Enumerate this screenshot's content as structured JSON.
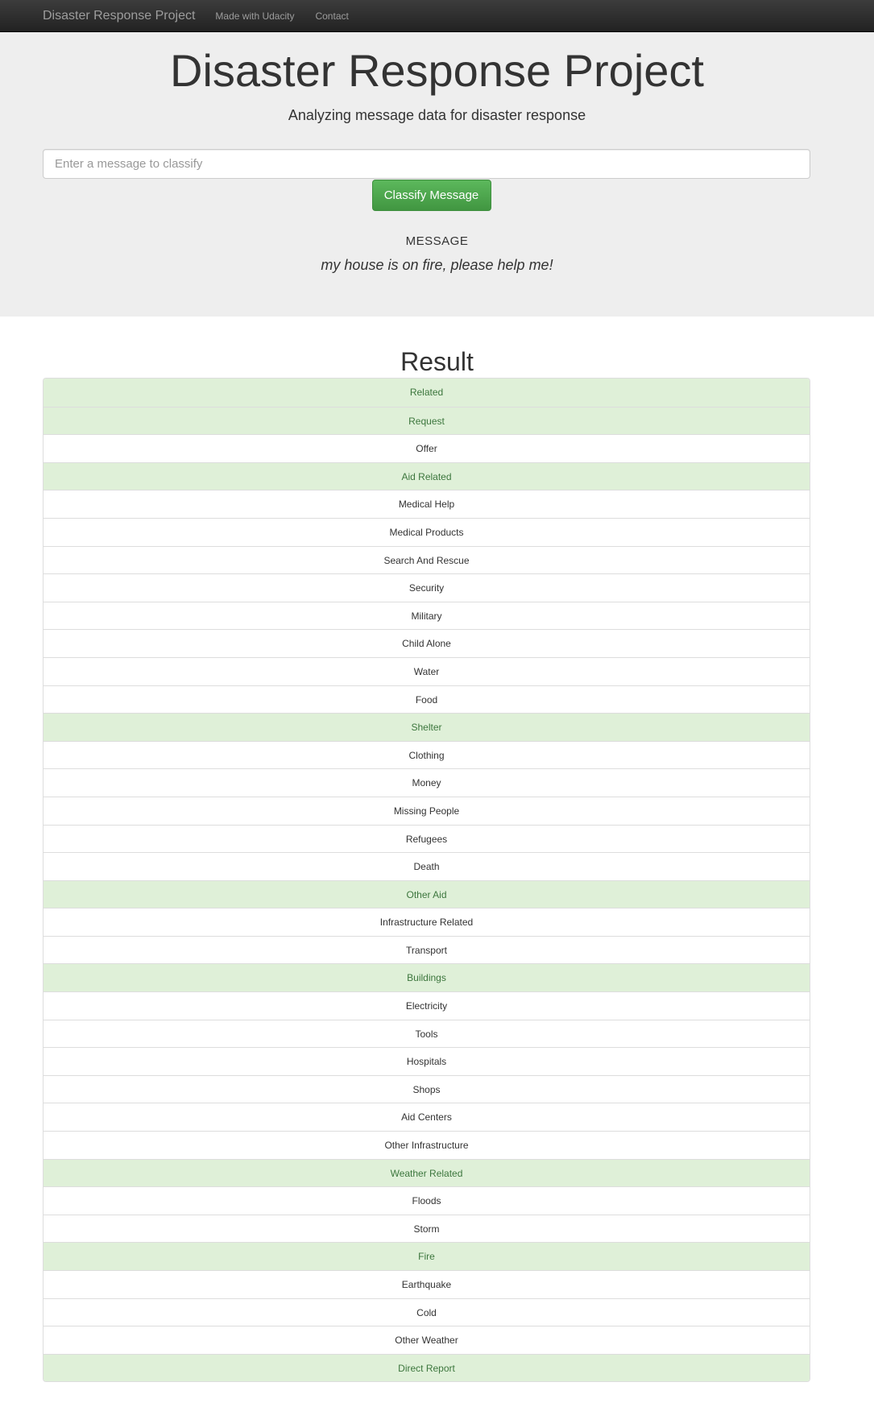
{
  "navbar": {
    "brand": "Disaster Response Project",
    "links": [
      "Made with Udacity",
      "Contact"
    ]
  },
  "header": {
    "title": "Disaster Response Project",
    "subtitle": "Analyzing message data for disaster response"
  },
  "form": {
    "placeholder": "Enter a message to classify",
    "button_label": "Classify Message"
  },
  "message": {
    "heading": "MESSAGE",
    "text": "my house is on fire, please help me!"
  },
  "result": {
    "title": "Result",
    "items": [
      {
        "label": "Related",
        "positive": true
      },
      {
        "label": "Request",
        "positive": true
      },
      {
        "label": "Offer",
        "positive": false
      },
      {
        "label": "Aid Related",
        "positive": true
      },
      {
        "label": "Medical Help",
        "positive": false
      },
      {
        "label": "Medical Products",
        "positive": false
      },
      {
        "label": "Search And Rescue",
        "positive": false
      },
      {
        "label": "Security",
        "positive": false
      },
      {
        "label": "Military",
        "positive": false
      },
      {
        "label": "Child Alone",
        "positive": false
      },
      {
        "label": "Water",
        "positive": false
      },
      {
        "label": "Food",
        "positive": false
      },
      {
        "label": "Shelter",
        "positive": true
      },
      {
        "label": "Clothing",
        "positive": false
      },
      {
        "label": "Money",
        "positive": false
      },
      {
        "label": "Missing People",
        "positive": false
      },
      {
        "label": "Refugees",
        "positive": false
      },
      {
        "label": "Death",
        "positive": false
      },
      {
        "label": "Other Aid",
        "positive": true
      },
      {
        "label": "Infrastructure Related",
        "positive": false
      },
      {
        "label": "Transport",
        "positive": false
      },
      {
        "label": "Buildings",
        "positive": true
      },
      {
        "label": "Electricity",
        "positive": false
      },
      {
        "label": "Tools",
        "positive": false
      },
      {
        "label": "Hospitals",
        "positive": false
      },
      {
        "label": "Shops",
        "positive": false
      },
      {
        "label": "Aid Centers",
        "positive": false
      },
      {
        "label": "Other Infrastructure",
        "positive": false
      },
      {
        "label": "Weather Related",
        "positive": true
      },
      {
        "label": "Floods",
        "positive": false
      },
      {
        "label": "Storm",
        "positive": false
      },
      {
        "label": "Fire",
        "positive": true
      },
      {
        "label": "Earthquake",
        "positive": false
      },
      {
        "label": "Cold",
        "positive": false
      },
      {
        "label": "Other Weather",
        "positive": false
      },
      {
        "label": "Direct Report",
        "positive": true
      }
    ]
  },
  "colors": {
    "positive_bg": "#dff0d8",
    "positive_text": "#3c763d",
    "button_green": "#5cb85c",
    "navbar_bg": "#222222",
    "jumbotron_bg": "#eeeeee"
  }
}
